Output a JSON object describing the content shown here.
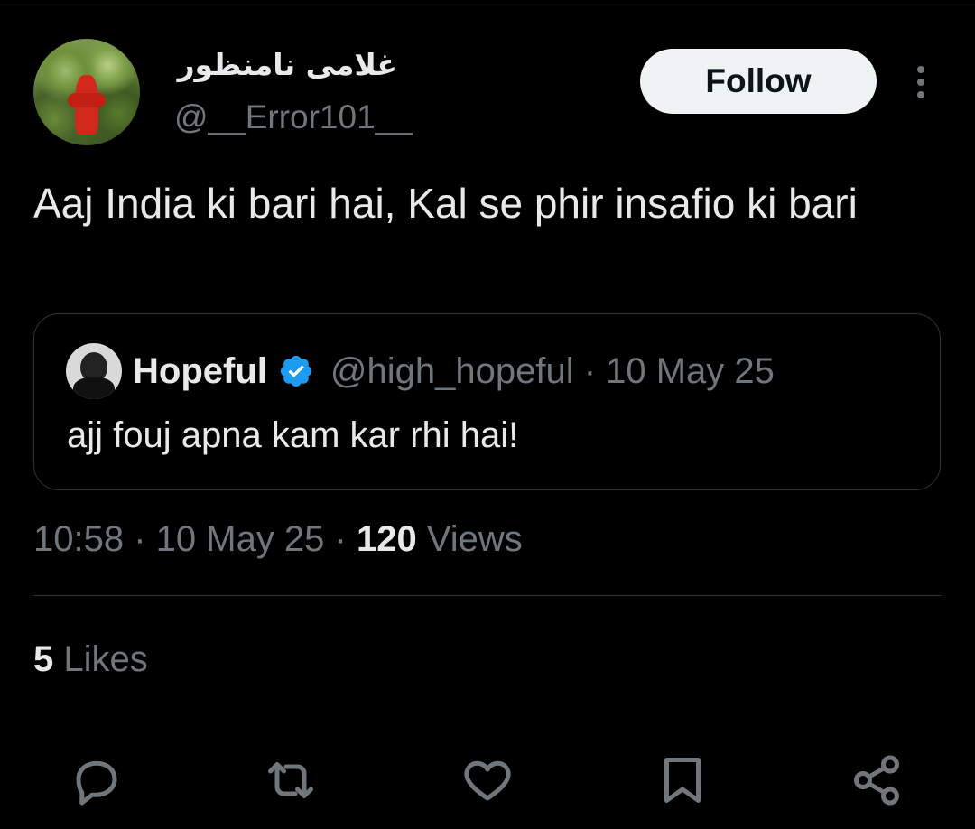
{
  "tweet": {
    "author": {
      "display_name": "غلامی نامنظور",
      "handle": "@__Error101__"
    },
    "follow_label": "Follow",
    "text": "Aaj India ki bari hai, Kal se phir insafio ki bari",
    "quoted": {
      "name": "Hopeful",
      "meta": "@high_hopeful · 10 May 25",
      "text": "ajj fouj apna kam kar rhi hai!"
    },
    "timestamp": "10:58 · 10 May 25 · ",
    "views_count": "120",
    "views_label": " Views",
    "likes_count": "5",
    "likes_label": " Likes"
  },
  "icons": {
    "more": "more-vertical-icon",
    "verified": "verified-badge-icon",
    "reply": "reply-icon",
    "retweet": "retweet-icon",
    "like": "heart-icon",
    "bookmark": "bookmark-icon",
    "share": "share-icon"
  },
  "colors": {
    "background": "#000000",
    "primary_text": "#e7e9ea",
    "secondary_text": "#71767b",
    "verified_blue": "#1d9bf0",
    "divider": "#2f3336"
  }
}
